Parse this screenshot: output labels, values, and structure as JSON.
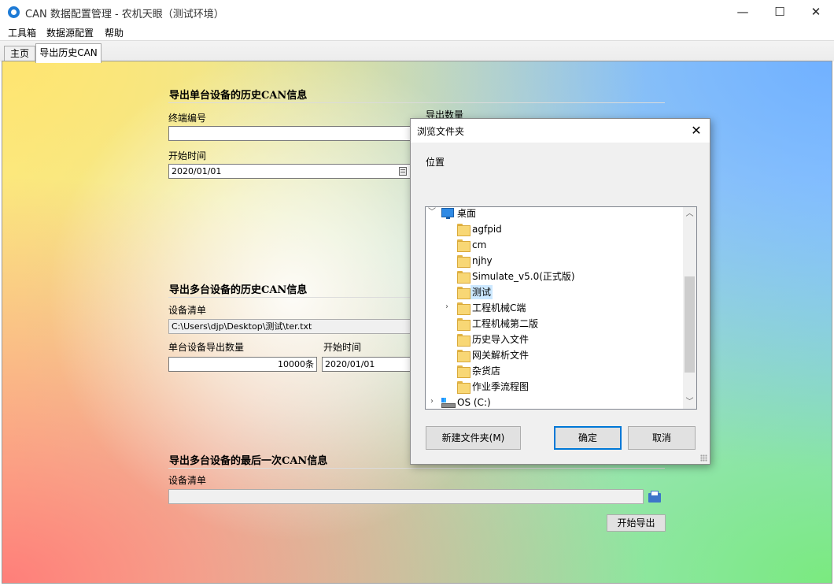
{
  "window": {
    "title": "CAN 数据配置管理 - 农机天眼（测试环境）",
    "minimize_glyph": "—",
    "maximize_glyph": "☐",
    "close_glyph": "✕"
  },
  "menu": [
    "工具箱",
    "数据源配置",
    "帮助"
  ],
  "tabs": [
    {
      "label": "主页",
      "active": false
    },
    {
      "label": "导出历史CAN",
      "active": true
    }
  ],
  "single_device": {
    "title": "导出单台设备的历史CAN信息",
    "terminal_label": "终端编号",
    "terminal_value": "",
    "count_label": "导出数量",
    "start_label": "开始时间",
    "start_value": "2020/01/01"
  },
  "multi_device": {
    "title": "导出多台设备的历史CAN信息",
    "list_label": "设备清单",
    "list_value": "C:\\Users\\djp\\Desktop\\测试\\ter.txt",
    "count_label": "单台设备导出数量",
    "count_value": "10000条",
    "start_label": "开始时间",
    "start_value": "2020/01/01"
  },
  "last_can": {
    "title": "导出多台设备的最后一次CAN信息",
    "list_label": "设备清单",
    "list_value": "",
    "export_button": "开始导出"
  },
  "dialog": {
    "title": "浏览文件夹",
    "location_label": "位置",
    "close_glyph": "✕",
    "tree": [
      {
        "label": "桌面",
        "icon": "desktop-icon",
        "expander": "﹀",
        "selected": false
      },
      {
        "label": "agfpid",
        "icon": "folder-icon",
        "expander": "",
        "selected": false
      },
      {
        "label": "cm",
        "icon": "folder-icon",
        "expander": "",
        "selected": false
      },
      {
        "label": "njhy",
        "icon": "folder-icon",
        "expander": "",
        "selected": false
      },
      {
        "label": "Simulate_v5.0(正式版)",
        "icon": "folder-icon",
        "expander": "",
        "selected": false
      },
      {
        "label": "测试",
        "icon": "folder-icon",
        "expander": "",
        "selected": true
      },
      {
        "label": "工程机械C端",
        "icon": "folder-icon",
        "expander": "›",
        "selected": false
      },
      {
        "label": "工程机械第二版",
        "icon": "folder-icon",
        "expander": "",
        "selected": false
      },
      {
        "label": "历史导入文件",
        "icon": "folder-icon",
        "expander": "",
        "selected": false
      },
      {
        "label": "网关解析文件",
        "icon": "folder-icon",
        "expander": "",
        "selected": false
      },
      {
        "label": "杂货店",
        "icon": "folder-icon",
        "expander": "",
        "selected": false
      },
      {
        "label": "作业季流程图",
        "icon": "folder-icon",
        "expander": "",
        "selected": false
      },
      {
        "label": "OS (C:)",
        "icon": "drive-icon",
        "expander": "›",
        "selected": false
      }
    ],
    "scroll_up_glyph": "︿",
    "scroll_down_glyph": "﹀",
    "new_folder_button": "新建文件夹(M)",
    "ok_button": "确定",
    "cancel_button": "取消"
  }
}
